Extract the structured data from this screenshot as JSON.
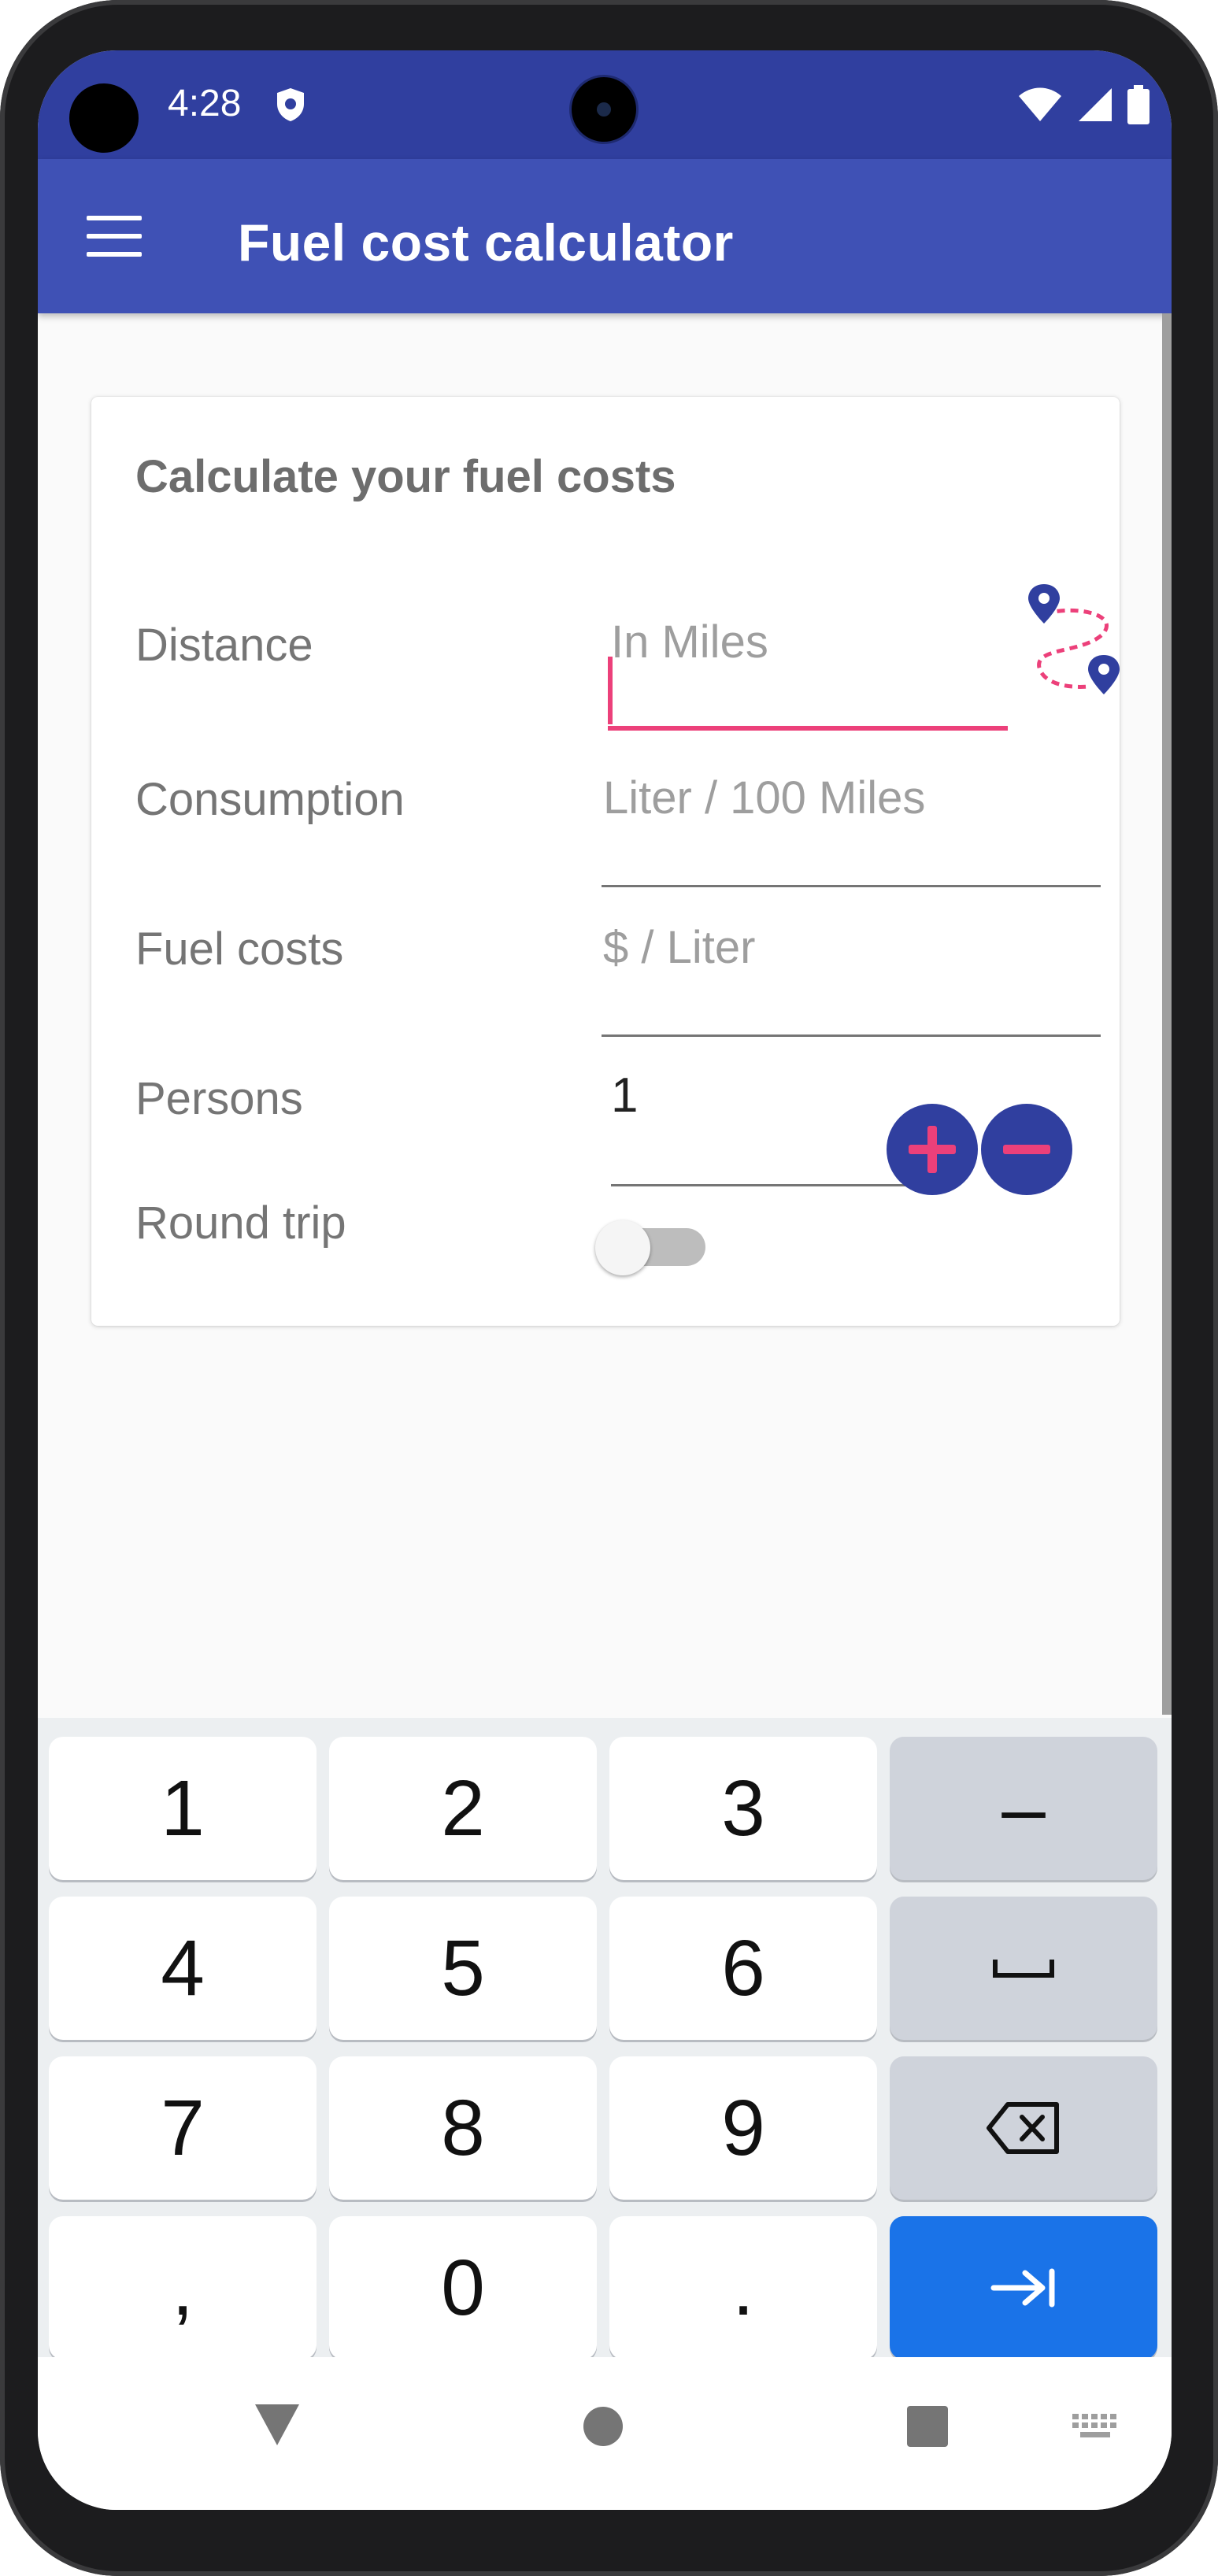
{
  "status_bar": {
    "time": "4:28"
  },
  "app_bar": {
    "title": "Fuel cost calculator"
  },
  "card": {
    "title": "Calculate your fuel costs",
    "distance": {
      "label": "Distance",
      "placeholder": "In Miles",
      "value": ""
    },
    "consumption": {
      "label": "Consumption",
      "placeholder": "Liter / 100 Miles",
      "value": ""
    },
    "fuel_costs": {
      "label": "Fuel costs",
      "placeholder": "$ / Liter",
      "value": ""
    },
    "persons": {
      "label": "Persons",
      "value": "1"
    },
    "round_trip": {
      "label": "Round trip",
      "enabled": false
    }
  },
  "keyboard": {
    "rows": [
      [
        "1",
        "2",
        "3",
        "–"
      ],
      [
        "4",
        "5",
        "6",
        "space"
      ],
      [
        "7",
        "8",
        "9",
        "backspace"
      ],
      [
        ",",
        "0",
        ".",
        "next"
      ]
    ]
  },
  "colors": {
    "primary": "#3f51b5",
    "primary_dark": "#303f9f",
    "accent": "#ec407a",
    "key_action": "#1a73e8"
  }
}
